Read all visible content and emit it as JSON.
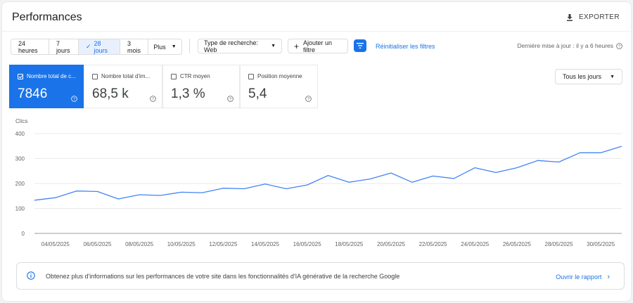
{
  "header": {
    "title": "Performances",
    "export_label": "EXPORTER"
  },
  "date_ranges": [
    {
      "label": "24 heures",
      "selected": false
    },
    {
      "label": "7 jours",
      "selected": false
    },
    {
      "label": "28 jours",
      "selected": true
    },
    {
      "label": "3 mois",
      "selected": false
    },
    {
      "label": "Plus",
      "selected": false
    }
  ],
  "filters": {
    "search_type": "Type de recherche: Web",
    "add_filter": "Ajouter un filtre",
    "reset": "Réinitialiser les filtres",
    "last_update": "Dernière mise à jour : il y a 6 heures"
  },
  "metrics": [
    {
      "label": "Nombre total de c...",
      "value": "7846",
      "selected": true
    },
    {
      "label": "Nombre total d'im...",
      "value": "68,5 k",
      "selected": false
    },
    {
      "label": "CTR moyen",
      "value": "1,3 %",
      "selected": false
    },
    {
      "label": "Position moyenne",
      "value": "5,4",
      "selected": false
    }
  ],
  "days_select": "Tous les jours",
  "chart_data": {
    "type": "line",
    "ylabel": "Clics",
    "ylim": [
      0,
      400
    ],
    "yticks": [
      0,
      100,
      200,
      300,
      400
    ],
    "x": [
      "03/05/2025",
      "04/05/2025",
      "05/05/2025",
      "06/05/2025",
      "07/05/2025",
      "08/05/2025",
      "09/05/2025",
      "10/05/2025",
      "11/05/2025",
      "12/05/2025",
      "13/05/2025",
      "14/05/2025",
      "15/05/2025",
      "16/05/2025",
      "17/05/2025",
      "18/05/2025",
      "19/05/2025",
      "20/05/2025",
      "21/05/2025",
      "22/05/2025",
      "23/05/2025",
      "24/05/2025",
      "25/05/2025",
      "26/05/2025",
      "27/05/2025",
      "28/05/2025",
      "29/05/2025",
      "30/05/2025"
    ],
    "xtick_labels": [
      "04/05/2025",
      "06/05/2025",
      "08/05/2025",
      "10/05/2025",
      "12/05/2025",
      "14/05/2025",
      "16/05/2025",
      "18/05/2025",
      "20/05/2025",
      "22/05/2025",
      "24/05/2025",
      "26/05/2025",
      "28/05/2025",
      "30/05/2025"
    ],
    "series": [
      {
        "values": [
          133,
          143,
          170,
          168,
          138,
          155,
          152,
          165,
          163,
          181,
          179,
          198,
          179,
          194,
          232,
          205,
          218,
          242,
          205,
          230,
          220,
          263,
          244,
          263,
          292,
          286,
          323,
          323,
          349
        ],
        "color": "#4285f4"
      }
    ],
    "grid": true
  },
  "info_banner": {
    "text": "Obtenez plus d'informations sur les performances de votre site dans les fonctionnalités d'IA générative de la recherche Google",
    "link": "Ouvrir le rapport"
  }
}
